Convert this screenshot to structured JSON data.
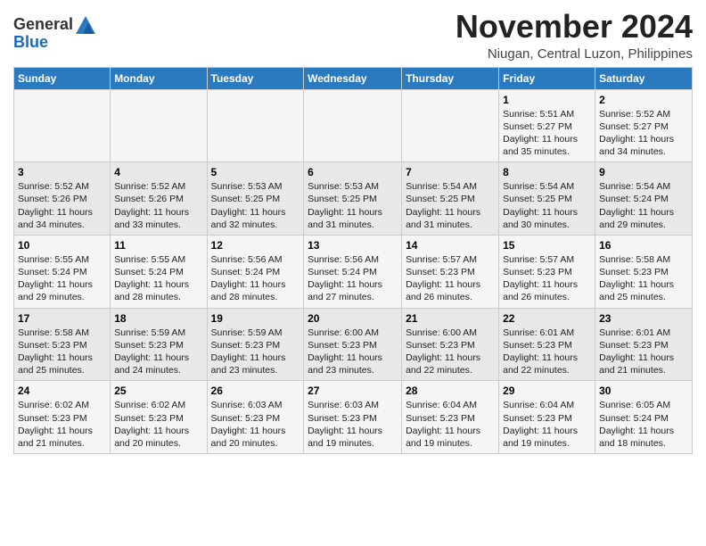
{
  "header": {
    "logo_line1": "General",
    "logo_line2": "Blue",
    "month": "November 2024",
    "location": "Niugan, Central Luzon, Philippines"
  },
  "days_of_week": [
    "Sunday",
    "Monday",
    "Tuesday",
    "Wednesday",
    "Thursday",
    "Friday",
    "Saturday"
  ],
  "weeks": [
    [
      {
        "day": "",
        "info": ""
      },
      {
        "day": "",
        "info": ""
      },
      {
        "day": "",
        "info": ""
      },
      {
        "day": "",
        "info": ""
      },
      {
        "day": "",
        "info": ""
      },
      {
        "day": "1",
        "info": "Sunrise: 5:51 AM\nSunset: 5:27 PM\nDaylight: 11 hours\nand 35 minutes."
      },
      {
        "day": "2",
        "info": "Sunrise: 5:52 AM\nSunset: 5:27 PM\nDaylight: 11 hours\nand 34 minutes."
      }
    ],
    [
      {
        "day": "3",
        "info": "Sunrise: 5:52 AM\nSunset: 5:26 PM\nDaylight: 11 hours\nand 34 minutes."
      },
      {
        "day": "4",
        "info": "Sunrise: 5:52 AM\nSunset: 5:26 PM\nDaylight: 11 hours\nand 33 minutes."
      },
      {
        "day": "5",
        "info": "Sunrise: 5:53 AM\nSunset: 5:25 PM\nDaylight: 11 hours\nand 32 minutes."
      },
      {
        "day": "6",
        "info": "Sunrise: 5:53 AM\nSunset: 5:25 PM\nDaylight: 11 hours\nand 31 minutes."
      },
      {
        "day": "7",
        "info": "Sunrise: 5:54 AM\nSunset: 5:25 PM\nDaylight: 11 hours\nand 31 minutes."
      },
      {
        "day": "8",
        "info": "Sunrise: 5:54 AM\nSunset: 5:25 PM\nDaylight: 11 hours\nand 30 minutes."
      },
      {
        "day": "9",
        "info": "Sunrise: 5:54 AM\nSunset: 5:24 PM\nDaylight: 11 hours\nand 29 minutes."
      }
    ],
    [
      {
        "day": "10",
        "info": "Sunrise: 5:55 AM\nSunset: 5:24 PM\nDaylight: 11 hours\nand 29 minutes."
      },
      {
        "day": "11",
        "info": "Sunrise: 5:55 AM\nSunset: 5:24 PM\nDaylight: 11 hours\nand 28 minutes."
      },
      {
        "day": "12",
        "info": "Sunrise: 5:56 AM\nSunset: 5:24 PM\nDaylight: 11 hours\nand 28 minutes."
      },
      {
        "day": "13",
        "info": "Sunrise: 5:56 AM\nSunset: 5:24 PM\nDaylight: 11 hours\nand 27 minutes."
      },
      {
        "day": "14",
        "info": "Sunrise: 5:57 AM\nSunset: 5:23 PM\nDaylight: 11 hours\nand 26 minutes."
      },
      {
        "day": "15",
        "info": "Sunrise: 5:57 AM\nSunset: 5:23 PM\nDaylight: 11 hours\nand 26 minutes."
      },
      {
        "day": "16",
        "info": "Sunrise: 5:58 AM\nSunset: 5:23 PM\nDaylight: 11 hours\nand 25 minutes."
      }
    ],
    [
      {
        "day": "17",
        "info": "Sunrise: 5:58 AM\nSunset: 5:23 PM\nDaylight: 11 hours\nand 25 minutes."
      },
      {
        "day": "18",
        "info": "Sunrise: 5:59 AM\nSunset: 5:23 PM\nDaylight: 11 hours\nand 24 minutes."
      },
      {
        "day": "19",
        "info": "Sunrise: 5:59 AM\nSunset: 5:23 PM\nDaylight: 11 hours\nand 23 minutes."
      },
      {
        "day": "20",
        "info": "Sunrise: 6:00 AM\nSunset: 5:23 PM\nDaylight: 11 hours\nand 23 minutes."
      },
      {
        "day": "21",
        "info": "Sunrise: 6:00 AM\nSunset: 5:23 PM\nDaylight: 11 hours\nand 22 minutes."
      },
      {
        "day": "22",
        "info": "Sunrise: 6:01 AM\nSunset: 5:23 PM\nDaylight: 11 hours\nand 22 minutes."
      },
      {
        "day": "23",
        "info": "Sunrise: 6:01 AM\nSunset: 5:23 PM\nDaylight: 11 hours\nand 21 minutes."
      }
    ],
    [
      {
        "day": "24",
        "info": "Sunrise: 6:02 AM\nSunset: 5:23 PM\nDaylight: 11 hours\nand 21 minutes."
      },
      {
        "day": "25",
        "info": "Sunrise: 6:02 AM\nSunset: 5:23 PM\nDaylight: 11 hours\nand 20 minutes."
      },
      {
        "day": "26",
        "info": "Sunrise: 6:03 AM\nSunset: 5:23 PM\nDaylight: 11 hours\nand 20 minutes."
      },
      {
        "day": "27",
        "info": "Sunrise: 6:03 AM\nSunset: 5:23 PM\nDaylight: 11 hours\nand 19 minutes."
      },
      {
        "day": "28",
        "info": "Sunrise: 6:04 AM\nSunset: 5:23 PM\nDaylight: 11 hours\nand 19 minutes."
      },
      {
        "day": "29",
        "info": "Sunrise: 6:04 AM\nSunset: 5:23 PM\nDaylight: 11 hours\nand 19 minutes."
      },
      {
        "day": "30",
        "info": "Sunrise: 6:05 AM\nSunset: 5:24 PM\nDaylight: 11 hours\nand 18 minutes."
      }
    ]
  ]
}
